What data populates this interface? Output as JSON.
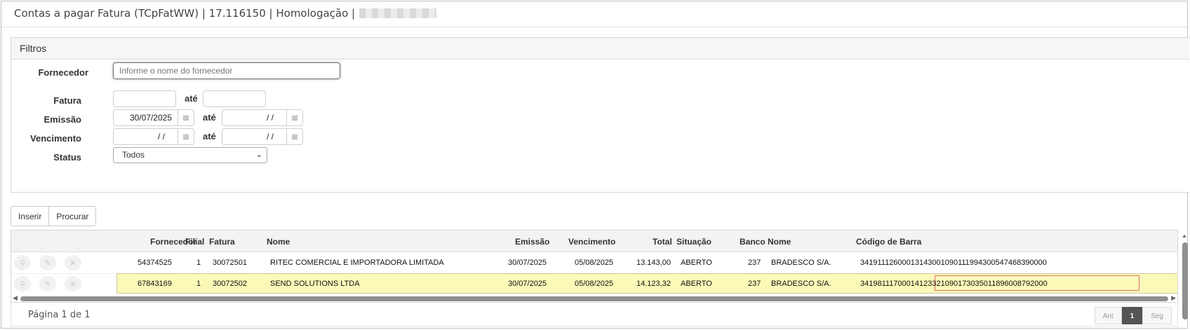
{
  "window": {
    "title": "Contas a pagar Fatura (TCpFatWW) | 17.116150 | Homologação |"
  },
  "filters": {
    "panel_title": "Filtros",
    "fornecedor_label": "Fornecedor",
    "fornecedor_placeholder": "Informe o nome do fornecedor",
    "fatura_label": "Fatura",
    "emissao_label": "Emissão",
    "vencimento_label": "Vencimento",
    "status_label": "Status",
    "ate_label": "até",
    "emissao_from": "30/07/2025",
    "emissao_to": "/ /",
    "vencimento_from": "/ /",
    "vencimento_to": "/ /",
    "status_value": "Todos"
  },
  "toolbar": {
    "insert_label": "Inserir",
    "search_label": "Procurar"
  },
  "grid": {
    "columns": {
      "fornecedor": "Fornecedor",
      "filial": "Filial",
      "fatura": "Fatura",
      "nome": "Nome",
      "emissao": "Emissão",
      "vencimento": "Vencimento",
      "total": "Total",
      "situacao": "Situação",
      "banco": "Banco",
      "banco_nome": "Nome",
      "codigo_barra": "Código de Barra"
    },
    "rows": [
      {
        "fornecedor": "54374525",
        "filial": "1",
        "fatura": "30072501",
        "nome": "RITEC COMERCIAL E IMPORTADORA LIMITADA",
        "emissao": "30/07/2025",
        "vencimento": "05/08/2025",
        "total": "13.143,00",
        "situacao": "ABERTO",
        "banco": "237",
        "banco_nome": "BRADESCO S/A.",
        "codigo_barra": "34191112600013143001090111994300547468390000",
        "selected": false
      },
      {
        "fornecedor": "67843169",
        "filial": "1",
        "fatura": "30072502",
        "nome": "SEND SOLUTIONS LTDA",
        "emissao": "30/07/2025",
        "vencimento": "05/08/2025",
        "total": "14.123,32",
        "situacao": "ABERTO",
        "banco": "237",
        "banco_nome": "BRADESCO S/A.",
        "codigo_barra": "34198111700014123321090173035011896008792000",
        "selected": true
      }
    ],
    "row_action_icons": [
      "search-icon",
      "edit-icon",
      "delete-icon"
    ]
  },
  "pagination": {
    "info": "Página 1 de 1",
    "prev_label": "Ant",
    "current_page": "1",
    "next_label": "Seg"
  },
  "colors": {
    "selected_row": "#fbf9b8",
    "highlight_border": "#e07070",
    "active_page": "#555555"
  }
}
